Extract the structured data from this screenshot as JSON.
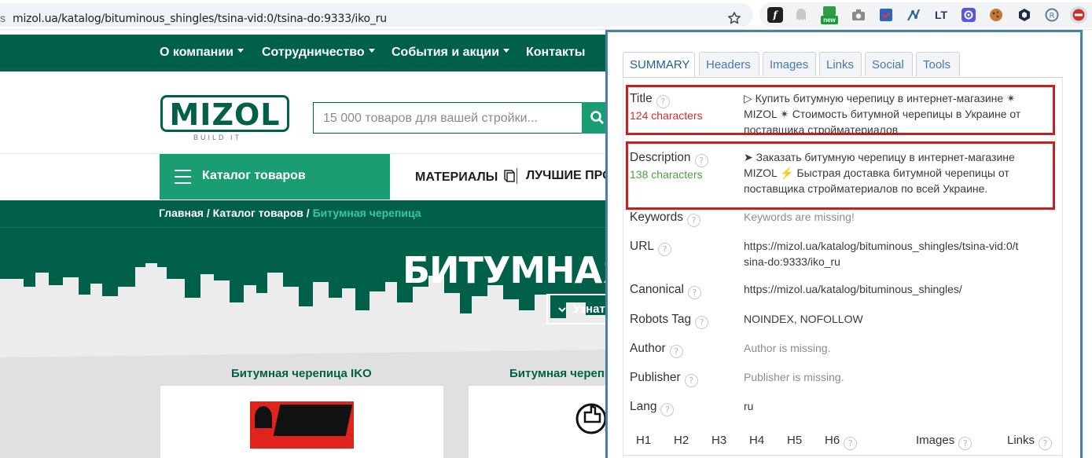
{
  "browser": {
    "url": "mizol.ua/katalog/bituminous_shingles/tsina-vid:0/tsina-do:9333/iko_ru",
    "url_left_char": "s",
    "extensions": [
      {
        "name": "fx-icon",
        "color": "#1f1f1f"
      },
      {
        "name": "ghost-icon",
        "color": "#b8b8b8"
      },
      {
        "name": "new-ext-icon",
        "color": "#1a9d3a",
        "badge": "new"
      },
      {
        "name": "camera-icon",
        "color": "#8a8a8a"
      },
      {
        "name": "todo-icon",
        "color": "#2b64c7"
      },
      {
        "name": "graph-icon",
        "color": "#2d6a8a"
      },
      {
        "name": "lt-icon",
        "color": "#1f3b66"
      },
      {
        "name": "gear-badge-icon",
        "color": "#5a55e0"
      },
      {
        "name": "cookie-icon",
        "color": "#b06a2a"
      },
      {
        "name": "cube-icon",
        "color": "#1f2a44"
      },
      {
        "name": "r-icon",
        "color": "#5e7f9a"
      },
      {
        "name": "seo-ext-icon",
        "color": "#c7312e"
      }
    ]
  },
  "site": {
    "topnav": [
      {
        "label": "О компании",
        "caret": true
      },
      {
        "label": "Сотрудничество",
        "caret": true
      },
      {
        "label": "События и акции",
        "caret": true
      },
      {
        "label": "Контакты",
        "caret": false
      }
    ],
    "logo": {
      "text": "MIZOL",
      "subtitle": "BUILD IT"
    },
    "search": {
      "placeholder": "15 000 товаров для вашей стройки..."
    },
    "catalog_label": "Каталог товаров",
    "menu": {
      "materials": "МАТЕРИАЛЫ",
      "best": "ЛУЧШИЕ ПРО"
    },
    "breadcrumb": {
      "home": "Главная",
      "sep": " / ",
      "catalog": "Каталог товаров",
      "current": "Битумная черепица"
    },
    "hero_title": "БИТУМНАЯ",
    "learn_label": "Узнат",
    "cards": [
      {
        "title": "Битумная черепица IKO"
      },
      {
        "title": "Битумная черепица"
      }
    ],
    "colors": {
      "brand": "#00604a",
      "accent": "#1a9d73"
    }
  },
  "panel": {
    "tabs": [
      "SUMMARY",
      "Headers",
      "Images",
      "Links",
      "Social",
      "Tools"
    ],
    "active_tab": "SUMMARY",
    "rows": {
      "title": {
        "label": "Title",
        "count": "124 characters",
        "value": "▷ Купить битумную черепицу в интернет-магазине ✴ MIZOL ✴ Стоимость битумной черепицы в Украине от поставщика стройматериалов"
      },
      "description": {
        "label": "Description",
        "count": "138 characters",
        "value": "➤ Заказать битумную черепицу в интернет-магазине MIZOL ⚡ Быстрая доставка битумной черепицы от поставщика стройматериалов по всей Украине."
      },
      "keywords": {
        "label": "Keywords",
        "value": "Keywords are missing!"
      },
      "url": {
        "label": "URL",
        "value": "https://mizol.ua/katalog/bituminous_shingles/tsina-vid:0/tsina-do:9333/iko_ru"
      },
      "canonical": {
        "label": "Canonical",
        "value": "https://mizol.ua/katalog/bituminous_shingles/"
      },
      "robots": {
        "label": "Robots Tag",
        "value": "NOINDEX, NOFOLLOW"
      },
      "author": {
        "label": "Author",
        "value": "Author is missing."
      },
      "publisher": {
        "label": "Publisher",
        "value": "Publisher is missing."
      },
      "lang": {
        "label": "Lang",
        "value": "ru"
      }
    },
    "headings": [
      "H1",
      "H2",
      "H3",
      "H4",
      "H5",
      "H6"
    ],
    "images_label": "Images",
    "links_label": "Links",
    "help_glyph": "?",
    "colors": {
      "title_count": "#d42a2a",
      "desc_count": "#4aa13f",
      "highlight": "#cc1f1f"
    }
  }
}
